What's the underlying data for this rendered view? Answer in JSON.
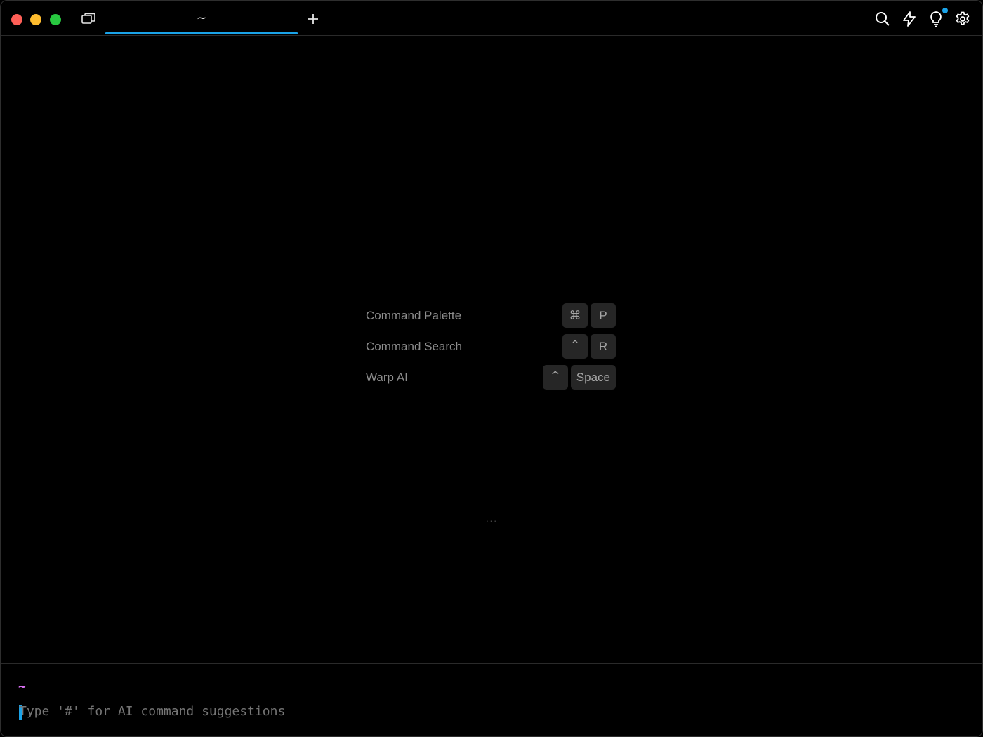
{
  "window": {
    "tab_title": "~"
  },
  "toolbar": {
    "icons": [
      "search-icon",
      "lightning-icon",
      "lightbulb-icon",
      "gear-icon"
    ],
    "accent_color": "#1aa3e8"
  },
  "hints": [
    {
      "label": "Command Palette",
      "keys": [
        "⌘",
        "P"
      ]
    },
    {
      "label": "Command Search",
      "keys": [
        "^",
        "R"
      ]
    },
    {
      "label": "Warp AI",
      "keys": [
        "^",
        "Space"
      ]
    }
  ],
  "divider_dots": "···",
  "prompt": {
    "directory": "~",
    "placeholder": "Type '#' for AI command suggestions"
  }
}
